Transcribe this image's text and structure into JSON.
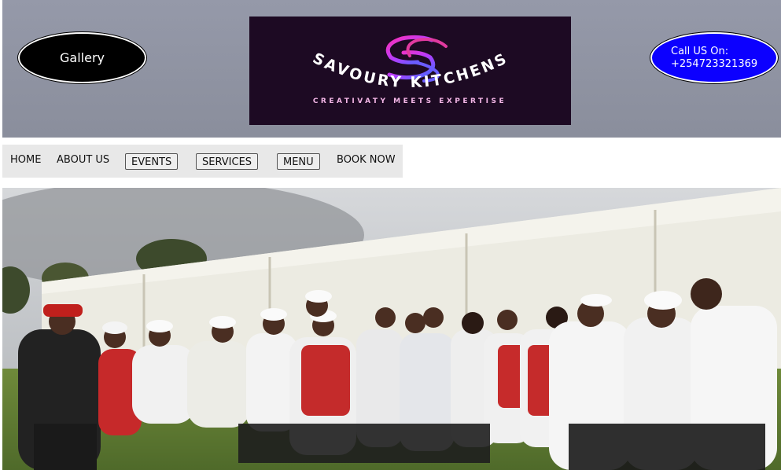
{
  "header": {
    "gallery_label": "Gallery",
    "call_line1": "Call US On:",
    "call_line2": "+254723321369",
    "logo": {
      "brand": "SAVOURY KITCHENS",
      "tagline": "CREATIVATY MEETS EXPERTISE",
      "monogram": "SS"
    }
  },
  "nav": {
    "home": "HOME",
    "about": "ABOUT US",
    "events": "EVENTS",
    "services": "SERVICES",
    "menu": "MENU",
    "book": "BOOK NOW"
  },
  "colors": {
    "header_bg": "#8e92a0",
    "call_button": "#0c00ff",
    "logo_bg": "#1d0a23",
    "nav_bg": "#e8e8e8"
  }
}
